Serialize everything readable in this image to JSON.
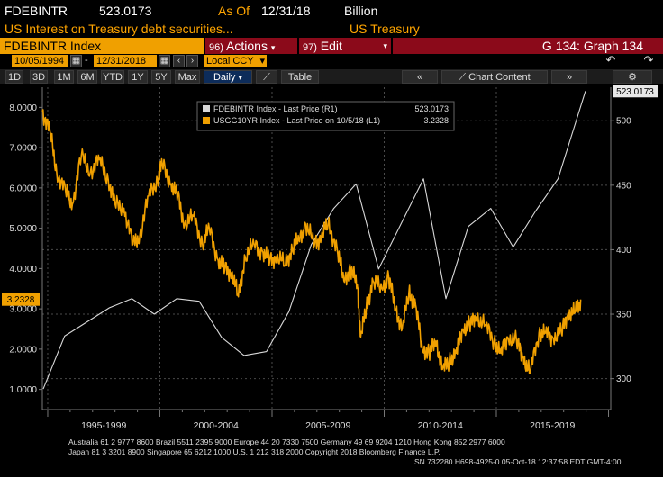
{
  "header": {
    "ticker": "FDEBINTR",
    "price": "523.0173",
    "as_of_label": "As Of",
    "as_of_date": "12/31/18",
    "units": "Billion",
    "description": "US Interest on Treasury debt securities...",
    "category": "US Treasury"
  },
  "toolbar": {
    "index_label": "FDEBINTR Index",
    "actions_num": "96)",
    "actions_label": "Actions",
    "edit_num": "97)",
    "edit_label": "Edit",
    "graph_label": "G 134: Graph 134"
  },
  "range": {
    "start_date": "10/05/1994",
    "end_date": "12/31/2018",
    "currency": "Local CCY"
  },
  "period_buttons": [
    "1D",
    "3D",
    "1M",
    "6M",
    "YTD",
    "1Y",
    "5Y",
    "Max"
  ],
  "frequency": "Daily",
  "table_label": "Table",
  "chart_content_label": "Chart Content",
  "chart_data": {
    "type": "line",
    "x_label": "",
    "year_range": [
      1994.76,
      2020.1
    ],
    "period_labels": [
      "1995-1999",
      "2000-2004",
      "2005-2009",
      "2010-2014",
      "2015-2019"
    ],
    "left_axis": {
      "ticks": [
        "8.0000",
        "7.0000",
        "6.0000",
        "5.0000",
        "4.0000",
        "3.0000",
        "2.0000",
        "1.0000"
      ],
      "range": [
        0.5,
        8.5
      ]
    },
    "right_axis": {
      "ticks": [
        "500",
        "450",
        "400",
        "350",
        "300"
      ],
      "range": [
        276,
        526
      ]
    },
    "legend": {
      "placement": "top-center"
    },
    "series": [
      {
        "name": "FDEBINTR Index - Last Price (R1)",
        "last_value": "523.0173",
        "axis": "right",
        "color": "#d8d8d8",
        "x": [
          1994.8,
          1995.75,
          1996.75,
          1997.75,
          1998.75,
          1999.75,
          2000.75,
          2001.75,
          2002.75,
          2003.75,
          2004.75,
          2005.75,
          2006.75,
          2007.75,
          2008.75,
          2009.75,
          2010.75,
          2011.75,
          2012.75,
          2013.75,
          2014.75,
          2015.75,
          2016.75,
          2017.75,
          2018.97
        ],
        "values": [
          292,
          333,
          344,
          355,
          362,
          350,
          362,
          360,
          332,
          318,
          321,
          352,
          404,
          432,
          451,
          385,
          420,
          455,
          362,
          418,
          432,
          402,
          430,
          455,
          523
        ]
      },
      {
        "name": "USGG10YR Index - Last Price on 10/5/18 (L1)",
        "last_value": "3.2328",
        "axis": "left",
        "color": "#f0a000",
        "x": [
          1994.76,
          1995.1,
          1995.4,
          1995.8,
          1996.1,
          1996.5,
          1996.9,
          1997.3,
          1997.7,
          1998.0,
          1998.4,
          1998.8,
          1999.1,
          1999.5,
          1999.9,
          2000.1,
          2000.5,
          2000.8,
          2001.1,
          2001.5,
          2001.9,
          2002.2,
          2002.6,
          2002.9,
          2003.2,
          2003.5,
          2003.8,
          2004.2,
          2004.6,
          2004.9,
          2005.2,
          2005.6,
          2005.9,
          2006.2,
          2006.5,
          2006.9,
          2007.2,
          2007.5,
          2007.9,
          2008.2,
          2008.5,
          2008.8,
          2008.95,
          2009.2,
          2009.5,
          2009.9,
          2010.2,
          2010.5,
          2010.8,
          2011.1,
          2011.4,
          2011.7,
          2012.0,
          2012.3,
          2012.6,
          2012.9,
          2013.2,
          2013.5,
          2013.8,
          2014.1,
          2014.5,
          2014.9,
          2015.2,
          2015.5,
          2015.9,
          2016.2,
          2016.5,
          2016.9,
          2017.2,
          2017.5,
          2017.9,
          2018.2,
          2018.5,
          2018.76
        ],
        "values": [
          7.9,
          7.4,
          6.4,
          5.9,
          5.6,
          6.8,
          6.4,
          6.7,
          6.2,
          5.6,
          5.5,
          4.6,
          4.8,
          5.8,
          6.2,
          6.6,
          6.1,
          5.8,
          5.1,
          5.3,
          4.6,
          5.0,
          4.2,
          4.0,
          3.9,
          3.3,
          4.3,
          4.6,
          4.4,
          4.2,
          4.3,
          4.1,
          4.5,
          4.7,
          5.1,
          4.6,
          4.8,
          5.1,
          4.5,
          3.7,
          4.0,
          3.6,
          2.3,
          3.0,
          3.7,
          3.5,
          3.8,
          3.0,
          2.5,
          3.4,
          3.1,
          2.0,
          1.9,
          2.2,
          1.5,
          1.7,
          1.9,
          2.5,
          2.6,
          2.8,
          2.6,
          2.2,
          1.9,
          2.3,
          2.2,
          1.8,
          1.4,
          2.4,
          2.4,
          2.3,
          2.4,
          2.9,
          2.9,
          3.2328
        ]
      }
    ]
  },
  "footer": {
    "line1": "Australia 61 2 9777 8600 Brazil 5511 2395 9000 Europe 44 20 7330 7500 Germany 49 69 9204 1210 Hong Kong 852 2977 6000",
    "line2": "Japan 81 3 3201 8900       Singapore 65 6212 1000       U.S. 1 212 318 2000            Copyright 2018 Bloomberg Finance L.P.",
    "line3": "SN 732280 H698-4925-0 05-Oct-18 12:37:58 EDT  GMT-4:00"
  }
}
